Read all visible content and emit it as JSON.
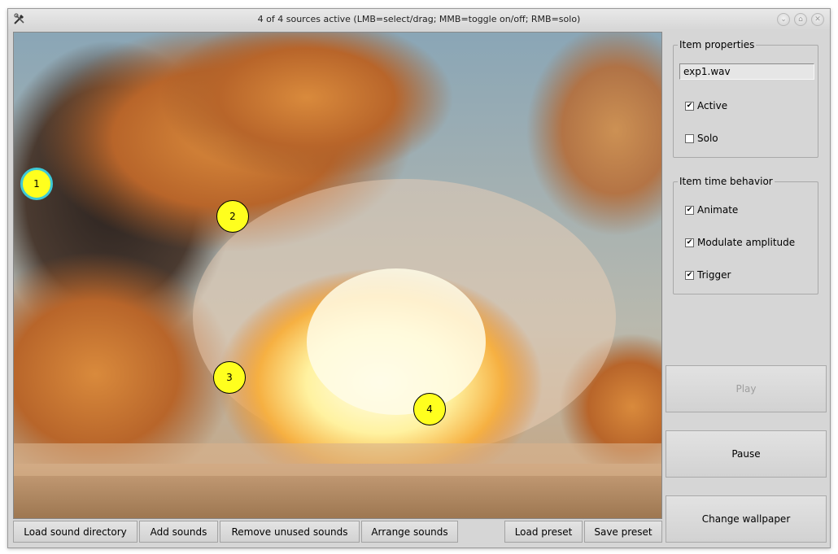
{
  "window": {
    "title": "4 of 4 sources active (LMB=select/drag; MMB=toggle on/off; RMB=solo)"
  },
  "canvas": {
    "sources": [
      {
        "label": "1",
        "selected": true
      },
      {
        "label": "2",
        "selected": false
      },
      {
        "label": "3",
        "selected": false
      },
      {
        "label": "4",
        "selected": false
      }
    ]
  },
  "item_properties": {
    "title": "Item properties",
    "name_value": "exp1.wav",
    "active": {
      "label": "Active",
      "checked": true
    },
    "solo": {
      "label": "Solo",
      "checked": false
    }
  },
  "item_time_behavior": {
    "title": "Item time behavior",
    "animate": {
      "label": "Animate",
      "checked": true
    },
    "modulate_amplitude": {
      "label": "Modulate amplitude",
      "checked": true
    },
    "trigger": {
      "label": "Trigger",
      "checked": true
    }
  },
  "buttons": {
    "play": "Play",
    "pause": "Pause",
    "change_wallpaper": "Change wallpaper",
    "load_sound_directory": "Load sound directory",
    "add_sounds": "Add sounds",
    "remove_unused_sounds": "Remove unused sounds",
    "arrange_sounds": "Arrange sounds",
    "load_preset": "Load preset",
    "save_preset": "Save preset"
  },
  "icons": {
    "app": "tools-icon",
    "titlebar_controls": [
      "minimize-icon",
      "maximize-icon",
      "close-icon"
    ]
  },
  "colors": {
    "source_fill": "#ffff1e",
    "selected_ring": "#3dc9d6"
  }
}
